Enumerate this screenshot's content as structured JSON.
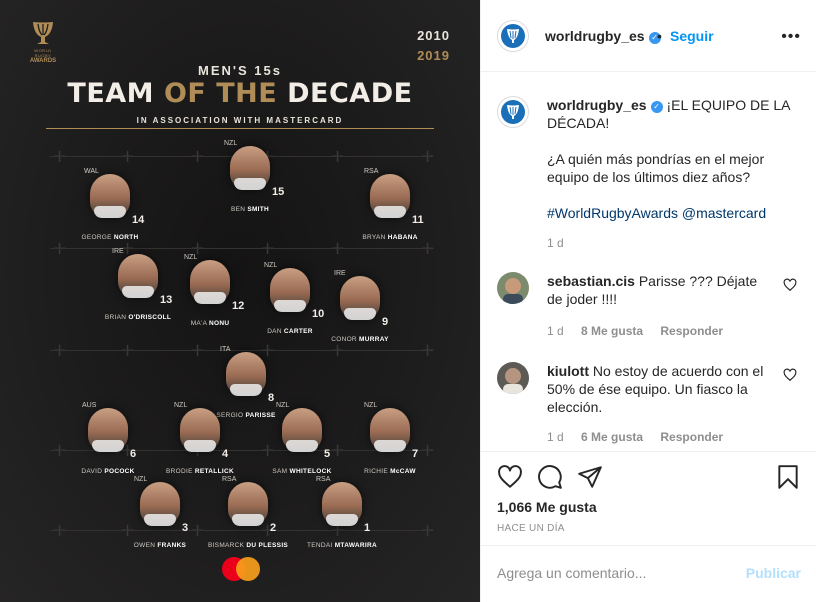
{
  "image": {
    "brand_small": "WORLD RUGBY",
    "brand_awards": "AWARDS",
    "year_start": "2010",
    "year_end": "2019",
    "subtitle": "MEN'S 15s",
    "title_white_1": "TEAM",
    "title_gold": "OF THE",
    "title_white_2": "DECADE",
    "association": "IN ASSOCIATION WITH MASTERCARD",
    "players": [
      {
        "country": "NZL",
        "number": "15",
        "first": "BEN",
        "last": "SMITH"
      },
      {
        "country": "WAL",
        "number": "14",
        "first": "GEORGE",
        "last": "NORTH"
      },
      {
        "country": "RSA",
        "number": "11",
        "first": "BRYAN",
        "last": "HABANA"
      },
      {
        "country": "IRE",
        "number": "13",
        "first": "BRIAN",
        "last": "O'DRISCOLL"
      },
      {
        "country": "NZL",
        "number": "12",
        "first": "MA'A",
        "last": "NONU"
      },
      {
        "country": "NZL",
        "number": "10",
        "first": "DAN",
        "last": "CARTER"
      },
      {
        "country": "IRE",
        "number": "9",
        "first": "CONOR",
        "last": "MURRAY"
      },
      {
        "country": "ITA",
        "number": "8",
        "first": "SERGIO",
        "last": "PARISSE"
      },
      {
        "country": "AUS",
        "number": "6",
        "first": "DAVID",
        "last": "POCOCK"
      },
      {
        "country": "NZL",
        "number": "4",
        "first": "BRODIE",
        "last": "RETALLICK"
      },
      {
        "country": "NZL",
        "number": "5",
        "first": "SAM",
        "last": "WHITELOCK"
      },
      {
        "country": "NZL",
        "number": "7",
        "first": "RICHIE",
        "last": "McCAW"
      },
      {
        "country": "NZL",
        "number": "3",
        "first": "OWEN",
        "last": "FRANKS"
      },
      {
        "country": "RSA",
        "number": "2",
        "first": "BISMARCK",
        "last": "DU PLESSIS"
      },
      {
        "country": "RSA",
        "number": "1",
        "first": "TENDAI",
        "last": "MTAWARIRA"
      }
    ]
  },
  "header": {
    "username": "worldrugby_es",
    "separator": "•",
    "follow_label": "Seguir",
    "more_icon": "more-options-icon"
  },
  "caption": {
    "username": "worldrugby_es",
    "line1": "¡EL EQUIPO DE LA DÉCADA!",
    "line2": "¿A quién más pondrías en el mejor equipo de los últimos diez años?",
    "tags": "#WorldRugbyAwards @mastercard",
    "time": "1 d"
  },
  "comments": [
    {
      "username": "sebastian.cis",
      "text": "Parisse ??? Déjate de joder !!!!",
      "time": "1 d",
      "likes": "8 Me gusta",
      "reply": "Responder"
    },
    {
      "username": "kiulott",
      "text": "No estoy de acuerdo con el 50% de ése equipo. Un fiasco la elección.",
      "time": "1 d",
      "likes": "6 Me gusta",
      "reply": "Responder"
    }
  ],
  "actions": {
    "icons": [
      "heart-icon",
      "comment-icon",
      "share-icon",
      "bookmark-icon"
    ],
    "likes": "1,066 Me gusta",
    "posted": "HACE UN DÍA"
  },
  "composer": {
    "placeholder": "Agrega un comentario...",
    "publish_label": "Publicar"
  },
  "colors": {
    "accent_gold": "#b08d57",
    "link_blue": "#0095f6",
    "publish_disabled": "#b2dffc"
  }
}
